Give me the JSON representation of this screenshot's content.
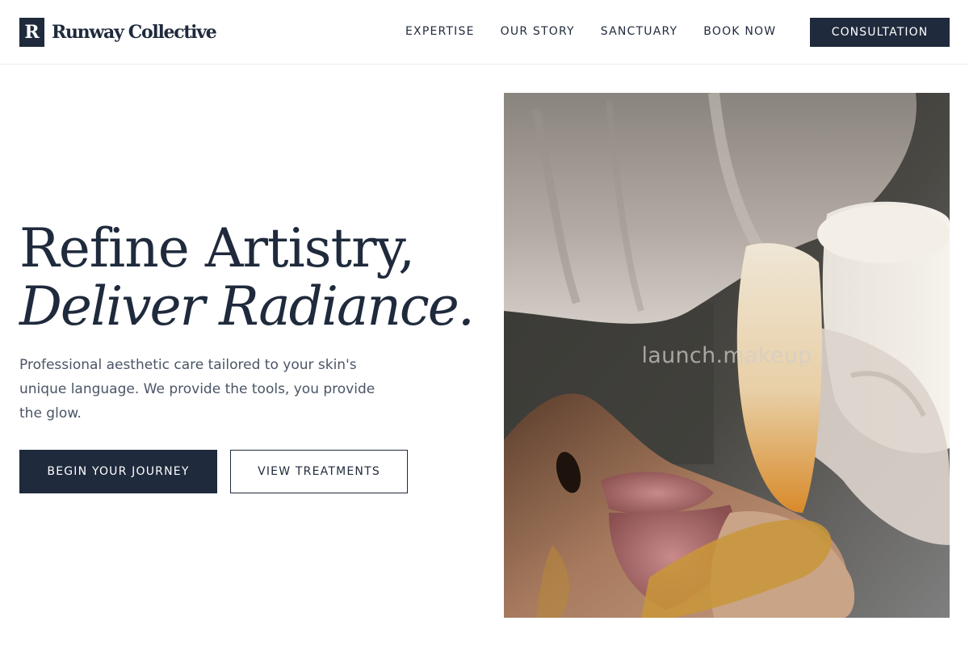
{
  "brand": {
    "mark": "R",
    "name": "Runway Collective"
  },
  "nav": {
    "items": [
      {
        "label": "EXPERTISE"
      },
      {
        "label": "OUR STORY"
      },
      {
        "label": "SANCTUARY"
      },
      {
        "label": "BOOK NOW"
      }
    ],
    "cta": "CONSULTATION"
  },
  "hero": {
    "title_line1": "Refine Artistry,",
    "title_line2": "Deliver Radiance.",
    "description": "Professional aesthetic care tailored to your skin's unique language. We provide the tools, you provide the glow.",
    "primary_button": "BEGIN YOUR JOURNEY",
    "secondary_button": "VIEW TREATMENTS",
    "image_watermark": "launch.makeup"
  },
  "colors": {
    "navy": "#1f2a3c",
    "body_text": "#4a5566",
    "background": "#ffffff"
  }
}
